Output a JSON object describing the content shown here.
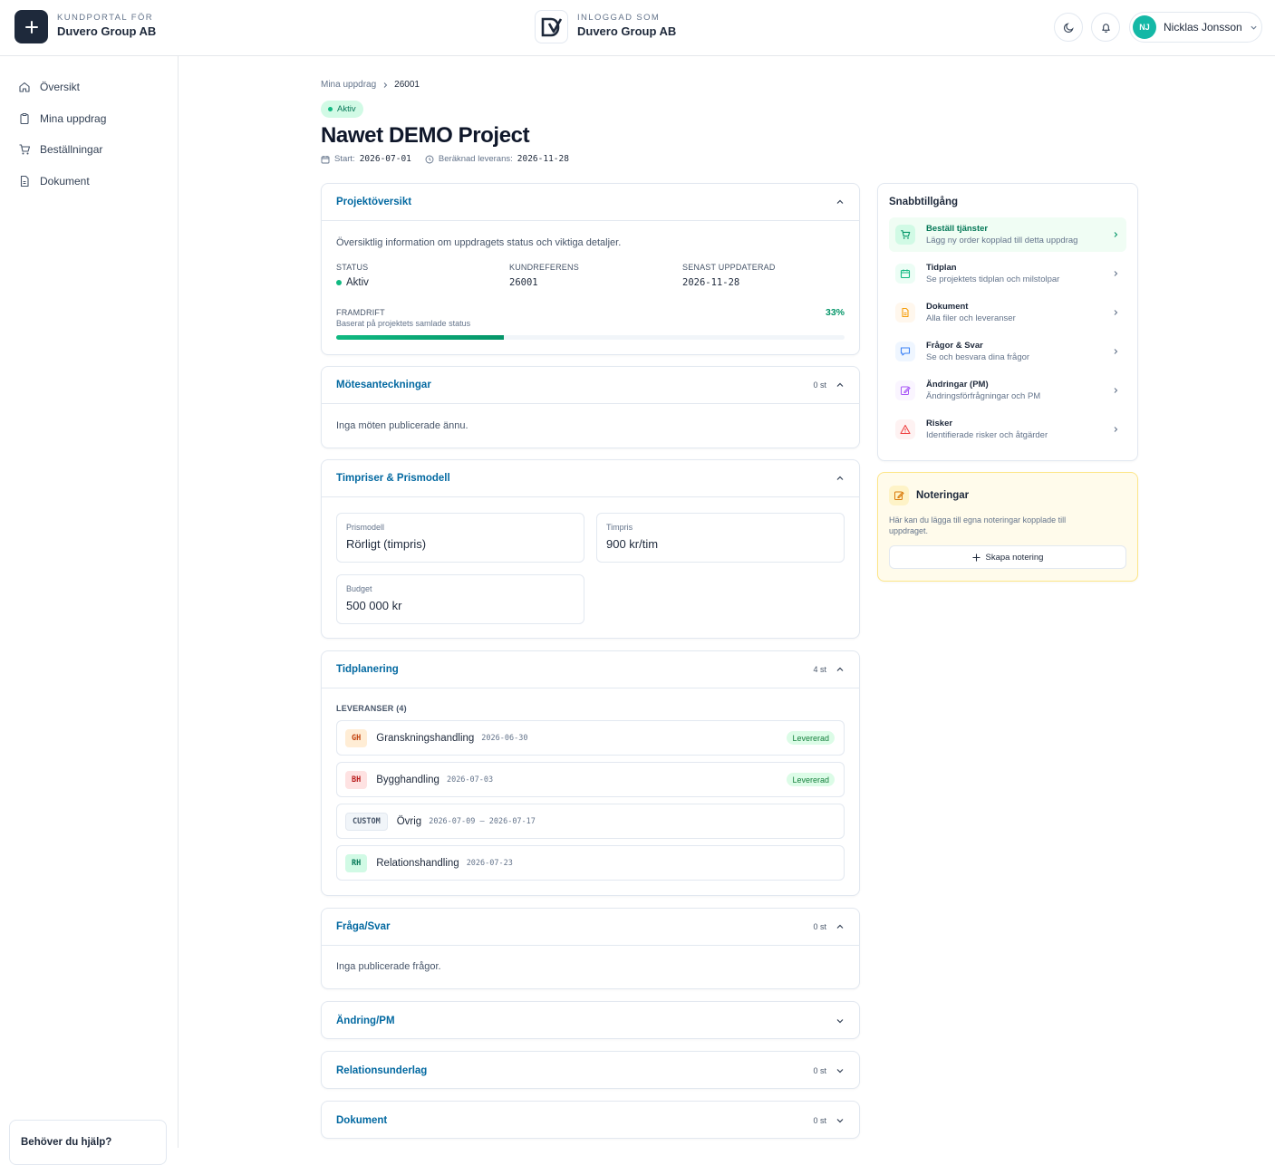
{
  "header": {
    "brand_kicker": "KUNDPORTAL FÖR",
    "brand_name": "Duvero Group AB",
    "logged_kicker": "INLOGGAD SOM",
    "logged_name": "Duvero Group AB",
    "user_initials": "NJ",
    "user_name": "Nicklas Jonsson"
  },
  "sidebar": {
    "items": [
      {
        "label": "Översikt",
        "icon": "home-icon"
      },
      {
        "label": "Mina uppdrag",
        "icon": "clipboard-icon"
      },
      {
        "label": "Beställningar",
        "icon": "cart-icon"
      },
      {
        "label": "Dokument",
        "icon": "document-icon"
      }
    ],
    "help": "Behöver du hjälp?"
  },
  "breadcrumb": {
    "parent": "Mina uppdrag",
    "current": "26001"
  },
  "project": {
    "status_badge": "Aktiv",
    "title": "Nawet DEMO Project",
    "start_label": "Start:",
    "start_date": "2026-07-01",
    "delivery_label": "Beräknad leverans:",
    "delivery_date": "2026-11-28"
  },
  "overview": {
    "title": "Projektöversikt",
    "description": "Översiktlig information om uppdragets status och viktiga detaljer.",
    "status_label": "STATUS",
    "status_value": "Aktiv",
    "ref_label": "KUNDREFERENS",
    "ref_value": "26001",
    "updated_label": "SENAST UPPDATERAD",
    "updated_value": "2026-11-28",
    "progress_label": "FRAMDRIFT",
    "progress_sub": "Baserat på projektets samlade status",
    "progress_text": "33%",
    "progress_value": 0.33
  },
  "meetings": {
    "title": "Mötesanteckningar",
    "count": "0 st",
    "empty": "Inga möten publicerade ännu."
  },
  "pricing": {
    "title": "Timpriser & Prismodell",
    "model_label": "Prismodell",
    "model_value": "Rörligt (timpris)",
    "rate_label": "Timpris",
    "rate_value": "900 kr/tim",
    "budget_label": "Budget",
    "budget_value": "500 000 kr"
  },
  "schedule": {
    "title": "Tidplanering",
    "count": "4 st",
    "deliveries_label": "LEVERANSER (4)",
    "items": [
      {
        "code": "GH",
        "name": "Granskningshandling",
        "date": "2026-06-30",
        "status": "Levererad"
      },
      {
        "code": "BH",
        "name": "Bygghandling",
        "date": "2026-07-03",
        "status": "Levererad"
      },
      {
        "code": "CUSTOM",
        "name": "Övrig",
        "date": "2026-07-09 – 2026-07-17",
        "status": ""
      },
      {
        "code": "RH",
        "name": "Relationshandling",
        "date": "2026-07-23",
        "status": ""
      }
    ]
  },
  "qa": {
    "title": "Fråga/Svar",
    "count": "0 st",
    "empty": "Inga publicerade frågor."
  },
  "change": {
    "title": "Ändring/PM"
  },
  "relation": {
    "title": "Relationsunderlag",
    "count": "0 st"
  },
  "documents": {
    "title": "Dokument",
    "count": "0 st"
  },
  "quick_access": {
    "title": "Snabbtillgång",
    "items": [
      {
        "title": "Beställ tjänster",
        "sub": "Lägg ny order kopplad till detta uppdrag",
        "icon": "cart-icon"
      },
      {
        "title": "Tidplan",
        "sub": "Se projektets tidplan och milstolpar",
        "icon": "calendar-icon"
      },
      {
        "title": "Dokument",
        "sub": "Alla filer och leveranser",
        "icon": "file-icon"
      },
      {
        "title": "Frågor & Svar",
        "sub": "Se och besvara dina frågor",
        "icon": "chat-icon"
      },
      {
        "title": "Ändringar (PM)",
        "sub": "Ändringsförfrågningar och PM",
        "icon": "edit-icon"
      },
      {
        "title": "Risker",
        "sub": "Identifierade risker och åtgärder",
        "icon": "warning-icon"
      }
    ]
  },
  "notes": {
    "title": "Noteringar",
    "text": "Här kan du lägga till egna noteringar kopplade till uppdraget.",
    "button": "Skapa notering"
  },
  "colors": {
    "accent": "#0369a1",
    "success": "#10b981",
    "dark": "#1e293b"
  }
}
